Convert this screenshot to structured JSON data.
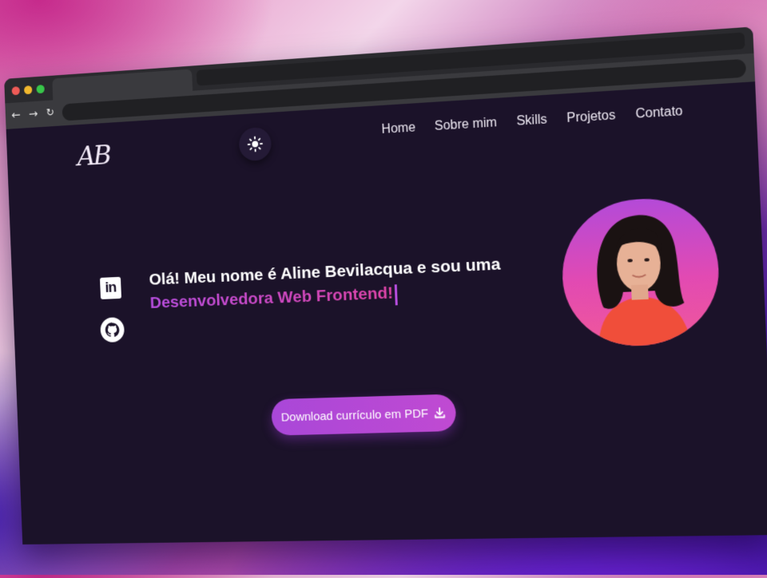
{
  "header": {
    "logo": "AB",
    "nav": [
      "Home",
      "Sobre mim",
      "Skills",
      "Projetos",
      "Contato"
    ]
  },
  "social": {
    "linkedin": "in"
  },
  "hero": {
    "greeting": "Olá! Meu nome é Aline Bevilacqua e sou uma",
    "role": "Desenvolvedora Web Frontend!"
  },
  "cta": {
    "download_label": "Download currículo em PDF"
  },
  "icons": {
    "theme": "sun-icon",
    "linkedin": "linkedin-icon",
    "github": "github-icon",
    "download": "download-icon"
  },
  "colors": {
    "background": "#1b1229",
    "accent": "#b84ee0",
    "accent2": "#e044a8"
  }
}
